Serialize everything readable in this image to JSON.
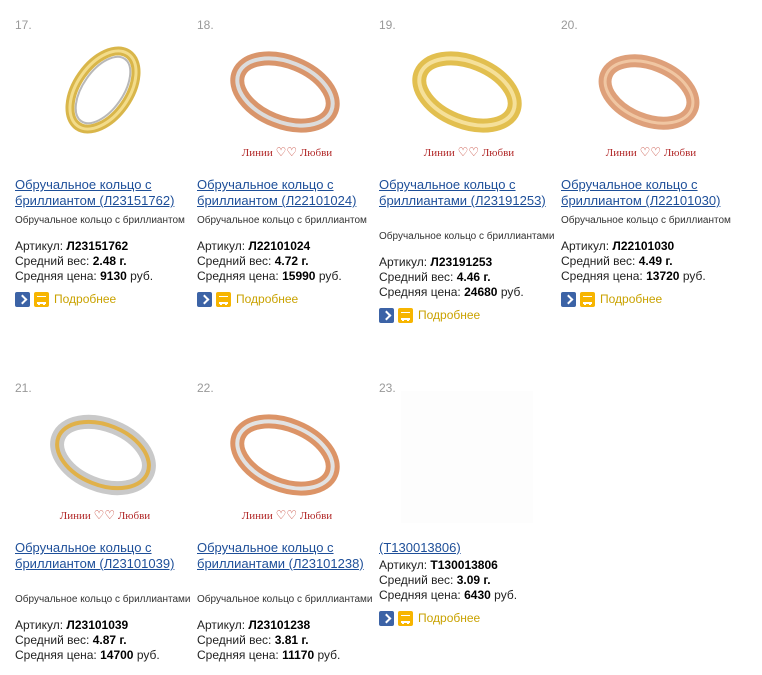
{
  "labels": {
    "sku": "Артикул:",
    "weight": "Средний вес:",
    "price": "Средняя цена:",
    "more": "Подробнее",
    "brand_left": "Линии",
    "brand_right": "Любви"
  },
  "products": [
    {
      "num": "17.",
      "title": "Обручальное кольцо с бриллиантом (Л23151762)",
      "desc": "Обручальное кольцо с бриллиантом",
      "sku": "Л23151762",
      "weight": "2.48 г.",
      "price": "9130",
      "currency": "руб.",
      "brand_logo": false,
      "ring": "yellow"
    },
    {
      "num": "18.",
      "title": "Обручальное кольцо с бриллиантом (Л22101024)",
      "desc": "Обручальное кольцо с бриллиантом",
      "sku": "Л22101024",
      "weight": "4.72 г.",
      "price": "15990",
      "currency": "руб.",
      "brand_logo": true,
      "ring": "rose"
    },
    {
      "num": "19.",
      "title": "Обручальное кольцо с бриллиантами (Л23191253)",
      "desc": "Обручальное кольцо с бриллиантами",
      "sku": "Л23191253",
      "weight": "4.46 г.",
      "price": "24680",
      "currency": "руб.",
      "brand_logo": true,
      "ring": "yellow"
    },
    {
      "num": "20.",
      "title": "Обручальное кольцо с бриллиантом (Л22101030)",
      "desc": "Обручальное кольцо с бриллиантом",
      "sku": "Л22101030",
      "weight": "4.49 г.",
      "price": "13720",
      "currency": "руб.",
      "brand_logo": true,
      "ring": "rose"
    },
    {
      "num": "21.",
      "title": "Обручальное кольцо с бриллиантом (Л23101039)",
      "desc": "Обручальное кольцо с бриллиантами",
      "sku": "Л23101039",
      "weight": "4.87 г.",
      "price": "14700",
      "currency": "руб.",
      "brand_logo": true,
      "ring": "white"
    },
    {
      "num": "22.",
      "title": "Обручальное кольцо с бриллиантами (Л23101238)",
      "desc": "Обручальное кольцо с бриллиантами",
      "sku": "Л23101238",
      "weight": "3.81 г.",
      "price": "11170",
      "currency": "руб.",
      "brand_logo": true,
      "ring": "rose"
    },
    {
      "num": "23.",
      "title": "(Т130013806)",
      "desc": "",
      "sku": "Т130013806",
      "weight": "3.09 г.",
      "price": "6430",
      "currency": "руб.",
      "brand_logo": false,
      "ring": "none"
    }
  ],
  "colors": {
    "link": "#1e4f99",
    "more": "#c9a200",
    "arrow_button": "#3c63a6",
    "cart_button": "#f7b500"
  }
}
